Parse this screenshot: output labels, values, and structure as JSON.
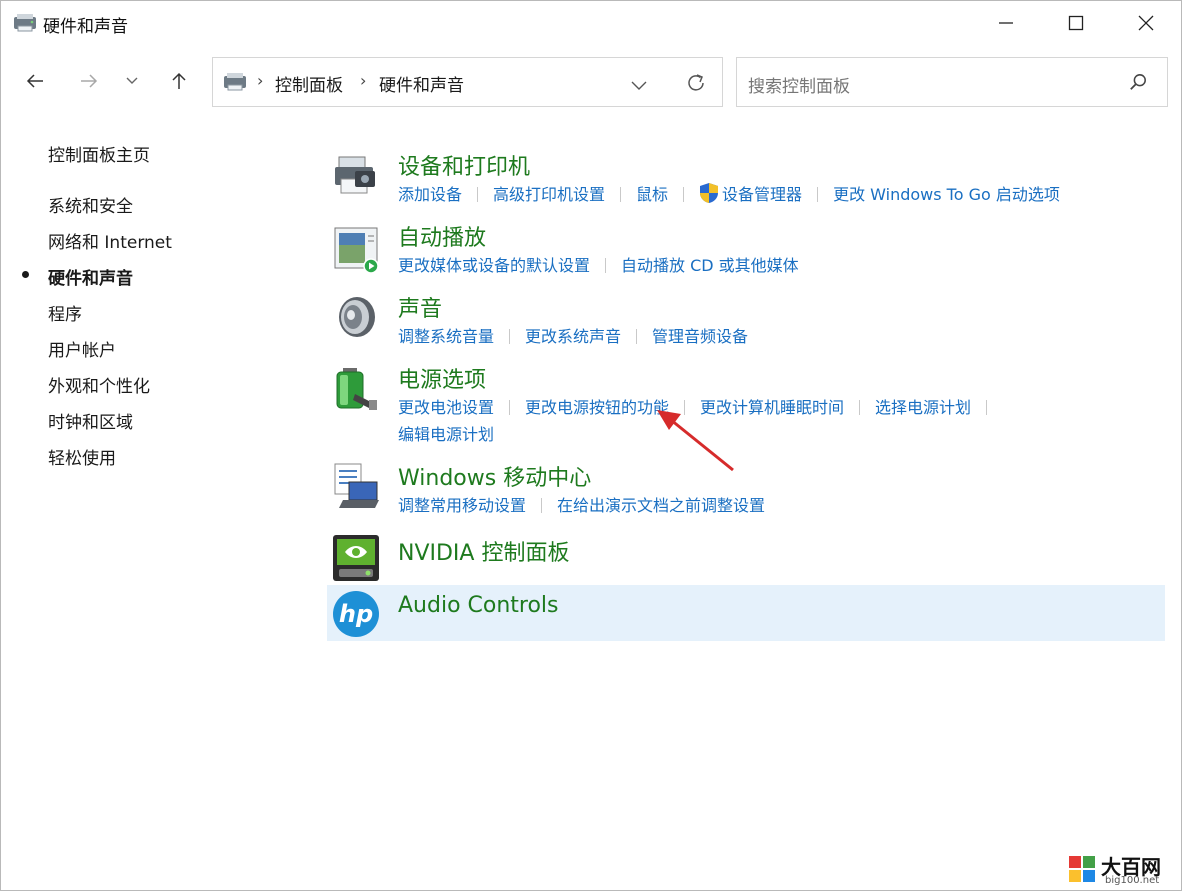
{
  "window": {
    "title": "硬件和声音",
    "controls": {
      "minimize": "minimize-icon",
      "maximize": "maximize-icon",
      "close": "close-icon"
    }
  },
  "nav": {
    "back_icon": "arrow-left-icon",
    "forward_icon": "arrow-right-icon",
    "recent_icon": "chevron-down-icon",
    "up_icon": "arrow-up-icon"
  },
  "address": {
    "crumbs": [
      "控制面板",
      "硬件和声音"
    ],
    "dropdown_icon": "chevron-down-icon",
    "refresh_icon": "refresh-icon"
  },
  "search": {
    "placeholder": "搜索控制面板",
    "icon": "search-icon"
  },
  "sidebar": {
    "items": [
      {
        "label": "控制面板主页",
        "current": false
      },
      {
        "label": "系统和安全",
        "current": false
      },
      {
        "label": "网络和 Internet",
        "current": false
      },
      {
        "label": "硬件和声音",
        "current": true
      },
      {
        "label": "程序",
        "current": false
      },
      {
        "label": "用户帐户",
        "current": false
      },
      {
        "label": "外观和个性化",
        "current": false
      },
      {
        "label": "时钟和区域",
        "current": false
      },
      {
        "label": "轻松使用",
        "current": false
      }
    ]
  },
  "categories": [
    {
      "title": "设备和打印机",
      "icon": "printer-icon",
      "links": [
        "添加设备",
        "高级打印机设置",
        "鼠标",
        "设备管理器",
        "更改 Windows To Go 启动选项"
      ]
    },
    {
      "title": "自动播放",
      "icon": "autoplay-icon",
      "links": [
        "更改媒体或设备的默认设置",
        "自动播放 CD 或其他媒体"
      ]
    },
    {
      "title": "声音",
      "icon": "speaker-icon",
      "links": [
        "调整系统音量",
        "更改系统声音",
        "管理音频设备"
      ]
    },
    {
      "title": "电源选项",
      "icon": "battery-icon",
      "links": [
        "更改电池设置",
        "更改电源按钮的功能",
        "更改计算机睡眠时间",
        "选择电源计划",
        "编辑电源计划"
      ]
    },
    {
      "title": "Windows 移动中心",
      "icon": "mobility-center-icon",
      "links": [
        "调整常用移动设置",
        "在给出演示文档之前调整设置"
      ]
    },
    {
      "title": "NVIDIA 控制面板",
      "icon": "nvidia-icon",
      "links": []
    },
    {
      "title": "Audio Controls",
      "icon": "hp-logo-icon",
      "links": []
    }
  ],
  "watermark": {
    "text": "大百网",
    "url": "big100.net"
  },
  "colors": {
    "category_title": "#1e7a1e",
    "link": "#1a6fc2",
    "highlight": "#e5f1fb",
    "arrow": "#d62b2b"
  }
}
